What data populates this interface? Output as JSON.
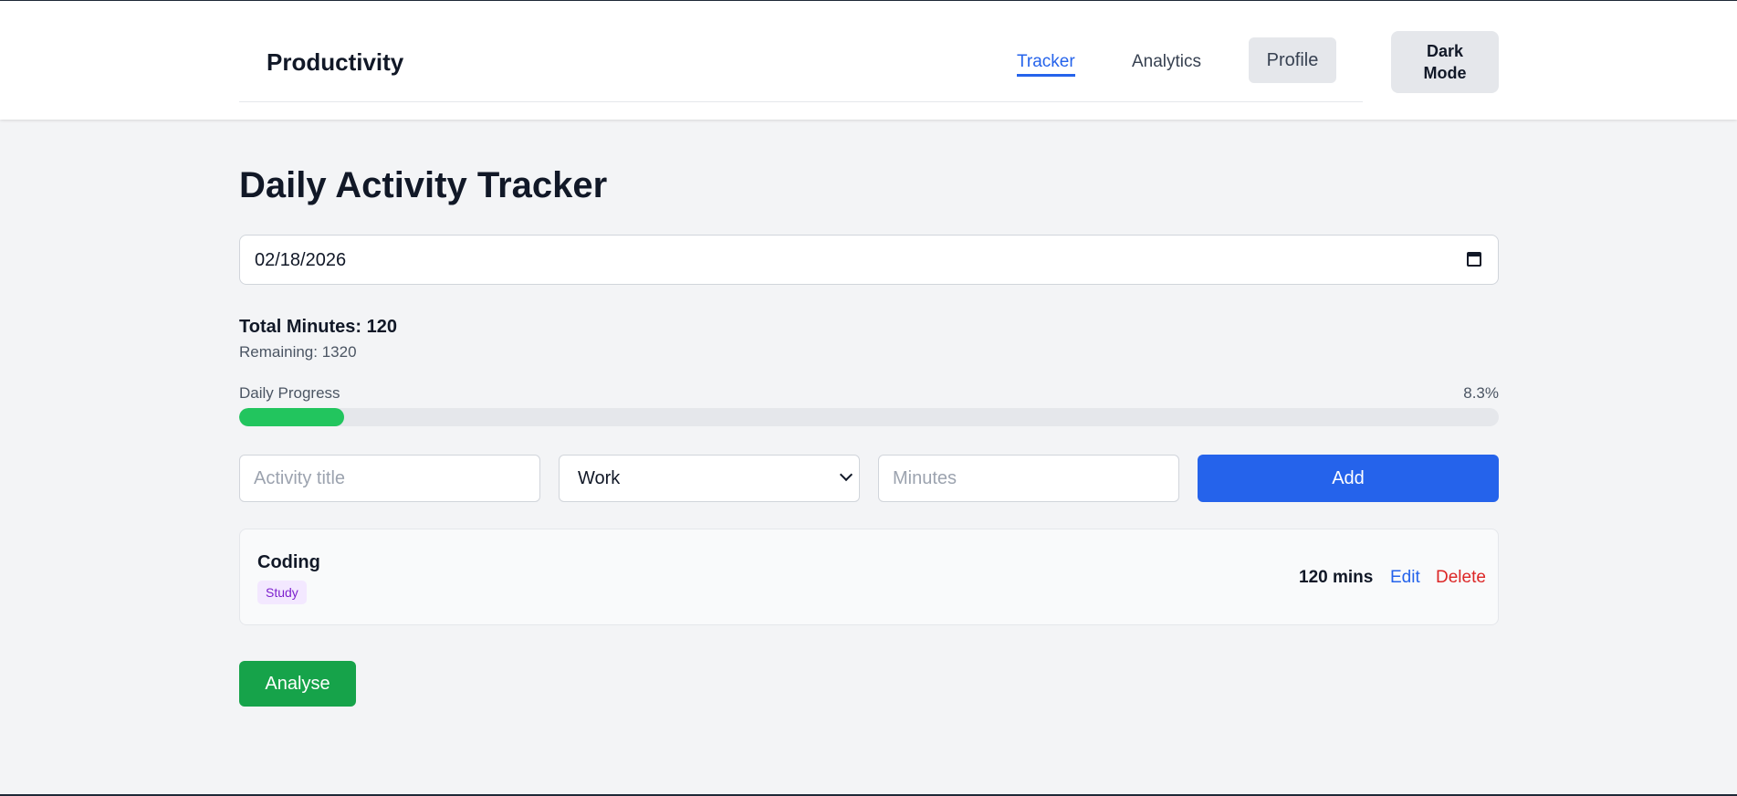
{
  "header": {
    "brand": "Productivity",
    "nav": {
      "tracker": "Tracker",
      "analytics": "Analytics",
      "profile": "Profile"
    },
    "dark_mode_label": "Dark\nMode"
  },
  "main": {
    "title": "Daily Activity Tracker",
    "date_value": "02/18/2026",
    "total_label": "Total Minutes: 120",
    "remaining_label": "Remaining: 1320",
    "progress": {
      "label": "Daily Progress",
      "percent_text": "8.3%",
      "percent": 8.3,
      "color": "#22c55e"
    },
    "form": {
      "title_placeholder": "Activity title",
      "category_selected": "Work",
      "minutes_placeholder": "Minutes",
      "add_label": "Add"
    },
    "activities": [
      {
        "name": "Coding",
        "category": "Study",
        "minutes": "120 mins",
        "edit_label": "Edit",
        "delete_label": "Delete"
      }
    ],
    "analyse_label": "Analyse"
  },
  "colors": {
    "accent": "#2563eb",
    "success": "#16a34a",
    "danger": "#dc2626"
  }
}
